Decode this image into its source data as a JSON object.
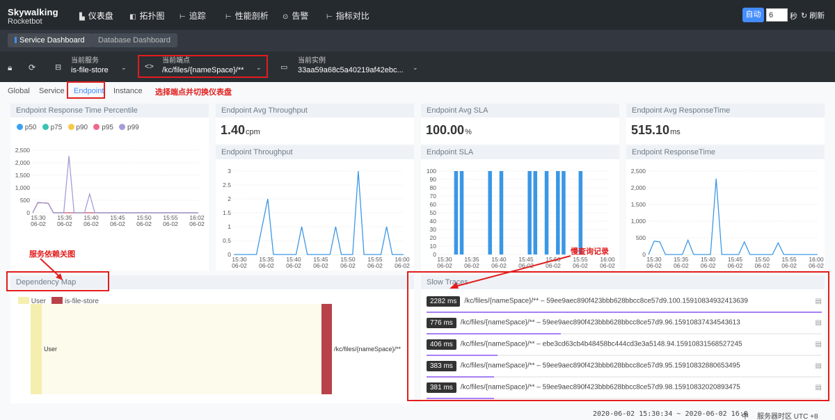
{
  "app": {
    "logo_line1": "Skywalking",
    "logo_line2": "Rocketbot"
  },
  "nav": {
    "items": [
      {
        "label": "仪表盘",
        "icon": "dashboard-icon"
      },
      {
        "label": "拓扑图",
        "icon": "topology-icon"
      },
      {
        "label": "追踪",
        "icon": "trace-icon"
      },
      {
        "label": "性能剖析",
        "icon": "profile-icon"
      },
      {
        "label": "告警",
        "icon": "alarm-icon"
      },
      {
        "label": "指标对比",
        "icon": "compare-icon"
      }
    ],
    "auto_label": "自动",
    "interval_value": "6",
    "seconds_label": "秒",
    "refresh_label": "刷新"
  },
  "dash_tabs": [
    "Service Dashboard",
    "Database Dashboard"
  ],
  "toolbar": {
    "service": {
      "title": "当前服务",
      "value": "is-file-store"
    },
    "endpoint": {
      "title": "当前端点",
      "value": "/kc/files/{nameSpace}/**"
    },
    "instance": {
      "title": "当前实例",
      "value": "33aa59a68c5a40219af42ebc..."
    }
  },
  "sub_tabs": [
    "Global",
    "Service",
    "Endpoint",
    "Instance"
  ],
  "annotations": {
    "switch": "选择端点并切换仪表盘",
    "dependency": "服务依赖关图",
    "slow": "慢查询记录"
  },
  "panels": {
    "percentile": {
      "title": "Endpoint Response Time Percentile",
      "legend": [
        "p50",
        "p75",
        "p90",
        "p95",
        "p99"
      ]
    },
    "avg_throughput": {
      "title": "Endpoint Avg Throughput",
      "value": "1.40",
      "unit": "cpm"
    },
    "avg_sla": {
      "title": "Endpoint Avg SLA",
      "value": "100.00",
      "unit": "%"
    },
    "avg_response": {
      "title": "Endpoint Avg ResponseTime",
      "value": "515.10",
      "unit": "ms"
    },
    "throughput": {
      "title": "Endpoint Throughput"
    },
    "sla": {
      "title": "Endpoint SLA"
    },
    "response": {
      "title": "Endpoint ResponseTime"
    },
    "dependency": {
      "title": "Dependency Map",
      "legend": [
        "User",
        "is-file-store"
      ],
      "node_left": "User",
      "node_right": "/kc/files/{nameSpace}/**"
    },
    "slow_traces": {
      "title": "Slow Traces"
    }
  },
  "slow_traces": [
    {
      "ms": "2282 ms",
      "text": "/kc/files/{nameSpace}/** – 59ee9aec890f423bbb628bbcc8ce57d9.100.15910834932413639",
      "fraction": 1.0
    },
    {
      "ms": "776 ms",
      "text": "/kc/files/{nameSpace}/** – 59ee9aec890f423bbb628bbcc8ce57d9.96.15910837434543613",
      "fraction": 0.34
    },
    {
      "ms": "406 ms",
      "text": "/kc/files/{nameSpace}/** – ebe3cd63cb4b48458bc444cd3e3a5148.94.15910831568527245",
      "fraction": 0.18
    },
    {
      "ms": "383 ms",
      "text": "/kc/files/{nameSpace}/** – 59ee9aec890f423bbb628bbcc8ce57d9.95.15910832880653495",
      "fraction": 0.17
    },
    {
      "ms": "381 ms",
      "text": "/kc/files/{nameSpace}/** – 59ee9aec890f423bbb628bbcc8ce57d9.98.15910832020893475",
      "fraction": 0.17
    }
  ],
  "footer": {
    "range": "2020-06-02 15:30:34 ~ 2020-06-02 16:0",
    "lang": "中",
    "tz": "服务器时区 UTC +8"
  },
  "colors": {
    "accent": "#448dfe",
    "annotation": "#e21d1d",
    "p50": "#3ba1f2",
    "p75": "#3bc3b3",
    "p90": "#f7c94a",
    "p95": "#ec6b8c",
    "p99": "#a59cd8",
    "user_node": "#f6eeae",
    "service_node": "#b84249",
    "trace_bar": "#a77ff5"
  },
  "chart_data": [
    {
      "type": "line",
      "title": "Endpoint Response Time Percentile",
      "categories": [
        "15:30\n06-02",
        "15:35\n06-02",
        "15:40\n06-02",
        "15:45\n06-02",
        "15:50\n06-02",
        "15:55\n06-02",
        "16:02\n06-02"
      ],
      "yticks": [
        0,
        500,
        1000,
        1500,
        2000,
        2500
      ],
      "ylim": [
        0,
        2500
      ],
      "x": [
        0,
        1,
        2,
        3,
        4,
        5,
        6,
        7,
        8,
        9,
        10,
        11,
        12,
        13,
        14,
        15,
        16,
        17,
        18,
        19,
        20,
        21,
        22,
        23,
        24,
        25,
        26,
        27,
        28,
        29,
        30,
        31,
        32
      ],
      "series": [
        {
          "name": "p50",
          "values": [
            0,
            400,
            400,
            380,
            0,
            0,
            0,
            0,
            0,
            0,
            0,
            0,
            0,
            0,
            0,
            0,
            0,
            0,
            0,
            0,
            0,
            0,
            0,
            0,
            0,
            0,
            0,
            0,
            0,
            0,
            0,
            0,
            0
          ]
        },
        {
          "name": "p75",
          "values": [
            0,
            400,
            400,
            380,
            0,
            0,
            0,
            0,
            0,
            0,
            0,
            0,
            0,
            0,
            0,
            0,
            0,
            0,
            0,
            0,
            0,
            0,
            0,
            0,
            0,
            0,
            0,
            0,
            0,
            0,
            0,
            0,
            0
          ]
        },
        {
          "name": "p90",
          "values": [
            0,
            400,
            400,
            380,
            0,
            0,
            0,
            0,
            0,
            0,
            0,
            0,
            0,
            0,
            0,
            0,
            0,
            0,
            0,
            0,
            0,
            0,
            0,
            0,
            0,
            0,
            0,
            0,
            0,
            0,
            0,
            0,
            0
          ]
        },
        {
          "name": "p95",
          "values": [
            0,
            400,
            400,
            380,
            0,
            0,
            0,
            0,
            0,
            0,
            0,
            0,
            0,
            0,
            0,
            0,
            0,
            0,
            0,
            0,
            0,
            0,
            0,
            0,
            0,
            0,
            0,
            0,
            0,
            0,
            0,
            0,
            0
          ]
        },
        {
          "name": "p99",
          "values": [
            0,
            420,
            400,
            370,
            0,
            0,
            0,
            2270,
            0,
            0,
            0,
            750,
            0,
            0,
            0,
            0,
            0,
            0,
            0,
            0,
            0,
            0,
            0,
            0,
            0,
            0,
            0,
            0,
            0,
            0,
            0,
            0,
            0
          ]
        }
      ],
      "grid": true,
      "legend": "top-left"
    },
    {
      "type": "line",
      "title": "Endpoint Throughput",
      "categories": [
        "15:30\n06-02",
        "15:35\n06-02",
        "15:40\n06-02",
        "15:45\n06-02",
        "15:50\n06-02",
        "15:55\n06-02",
        "16:00\n06-02"
      ],
      "yticks": [
        0,
        0.5,
        1,
        1.5,
        2,
        2.5,
        3
      ],
      "ylim": [
        0,
        3
      ],
      "x": [
        0,
        1,
        2,
        3,
        4,
        5,
        6,
        7,
        8,
        9,
        10,
        11,
        12,
        13,
        14,
        15,
        16,
        17,
        18,
        19,
        20,
        21,
        22,
        23,
        24,
        25,
        26,
        27,
        28,
        29,
        30
      ],
      "series": [
        {
          "name": "",
          "values": [
            0,
            0,
            0,
            0,
            0,
            1,
            2,
            0,
            0,
            0,
            0,
            0,
            1,
            0,
            0,
            0,
            0,
            0,
            1,
            0,
            0,
            0,
            3,
            0,
            0,
            0,
            0,
            1,
            0,
            0,
            0
          ]
        }
      ],
      "grid": true
    },
    {
      "type": "bar",
      "title": "Endpoint SLA",
      "categories": [
        "15:30\n06-02",
        "15:35\n06-02",
        "15:40\n06-02",
        "15:45\n06-02",
        "15:50\n06-02",
        "15:55\n06-02",
        "16:00\n06-02"
      ],
      "yticks": [
        0,
        10,
        20,
        30,
        40,
        50,
        60,
        70,
        80,
        90,
        100
      ],
      "ylim": [
        0,
        100
      ],
      "x": [
        0,
        1,
        2,
        3,
        4,
        5,
        6,
        7,
        8,
        9,
        10,
        11,
        12,
        13,
        14,
        15,
        16,
        17,
        18,
        19,
        20,
        21,
        22,
        23,
        24,
        25,
        26,
        27,
        28,
        29,
        30
      ],
      "values": [
        0,
        0,
        0,
        100,
        100,
        0,
        0,
        0,
        0,
        100,
        0,
        100,
        0,
        0,
        0,
        0,
        100,
        100,
        0,
        100,
        0,
        100,
        100,
        0,
        0,
        100,
        0,
        0,
        0,
        0,
        0
      ],
      "grid": true
    },
    {
      "type": "line",
      "title": "Endpoint ResponseTime",
      "categories": [
        "15:30\n06-02",
        "15:35\n06-02",
        "15:40\n06-02",
        "15:45\n06-02",
        "15:50\n06-02",
        "15:55\n06-02",
        "16:00\n06-02"
      ],
      "yticks": [
        0,
        500,
        1000,
        1500,
        2000,
        2500
      ],
      "ylim": [
        0,
        2500
      ],
      "x": [
        0,
        1,
        2,
        3,
        4,
        5,
        6,
        7,
        8,
        9,
        10,
        11,
        12,
        13,
        14,
        15,
        16,
        17,
        18,
        19,
        20,
        21,
        22,
        23,
        24,
        25,
        26,
        27,
        28,
        29,
        30
      ],
      "series": [
        {
          "name": "",
          "values": [
            0,
            400,
            380,
            0,
            0,
            0,
            0,
            430,
            0,
            0,
            0,
            0,
            2270,
            0,
            0,
            0,
            0,
            380,
            0,
            0,
            0,
            0,
            0,
            350,
            0,
            0,
            0,
            0,
            0,
            0,
            0
          ]
        }
      ],
      "grid": true
    }
  ]
}
